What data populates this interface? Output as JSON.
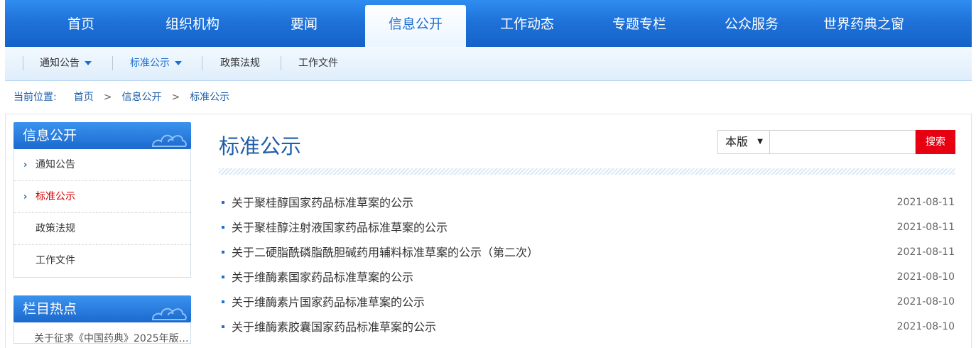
{
  "topnav": {
    "items": [
      "首页",
      "组织机构",
      "要闻",
      "信息公开",
      "工作动态",
      "专题专栏",
      "公众服务",
      "世界药典之窗"
    ],
    "active_index": 3
  },
  "subnav": {
    "items": [
      "通知公告",
      "标准公示",
      "政策法规",
      "工作文件"
    ]
  },
  "breadcrumb": {
    "label": "当前位置:",
    "items": [
      "首页",
      "信息公开",
      "标准公示"
    ],
    "separator": ">"
  },
  "sidebar": {
    "title": "信息公开",
    "items": [
      "通知公告",
      "标准公示",
      "政策法规",
      "工作文件"
    ],
    "active_index": 1,
    "hot_title": "栏目热点",
    "hot_partial": "关于征求《中国药典》2025年版…"
  },
  "main": {
    "title": "标准公示",
    "search": {
      "scope": "本版",
      "placeholder": "",
      "button": "搜索"
    },
    "list": [
      {
        "title": "关于聚桂醇国家药品标准草案的公示",
        "date": "2021-08-11"
      },
      {
        "title": "关于聚桂醇注射液国家药品标准草案的公示",
        "date": "2021-08-11"
      },
      {
        "title": "关于二硬脂酰磷脂酰胆碱药用辅料标准草案的公示（第二次）",
        "date": "2021-08-11"
      },
      {
        "title": "关于维酶素国家药品标准草案的公示",
        "date": "2021-08-10"
      },
      {
        "title": "关于维酶素片国家药品标准草案的公示",
        "date": "2021-08-10"
      },
      {
        "title": "关于维酶素胶囊国家药品标准草案的公示",
        "date": "2021-08-10"
      }
    ]
  },
  "colors": {
    "nav_blue": "#1f72d9",
    "accent_red": "#e60012",
    "link_blue": "#1f5fa8",
    "active_red": "#d40000"
  }
}
